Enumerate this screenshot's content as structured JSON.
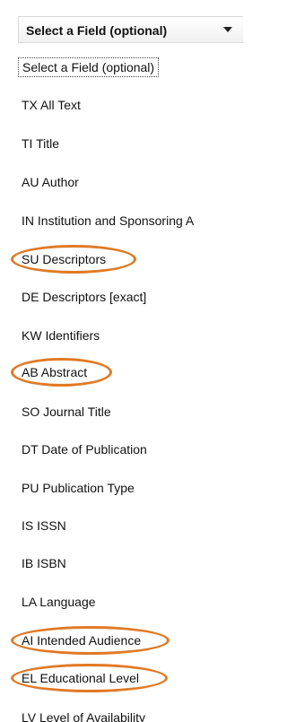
{
  "select": {
    "value": "Select a Field (optional)",
    "arrow_icon": "chevron-down-icon"
  },
  "options": [
    "Select a Field (optional)",
    "TX All Text",
    "TI Title",
    "AU Author",
    "IN Institution and Sponsoring A",
    "SU Descriptors",
    "DE Descriptors [exact]",
    "KW Identifiers",
    "AB Abstract",
    "SO Journal Title",
    "DT Date of Publication",
    "PU Publication Type",
    "IS ISSN",
    "IB ISBN",
    "LA Language",
    "AI Intended Audience",
    "EL Educational Level",
    "LV Level of Availability"
  ],
  "highlight_color": "#e07a26"
}
